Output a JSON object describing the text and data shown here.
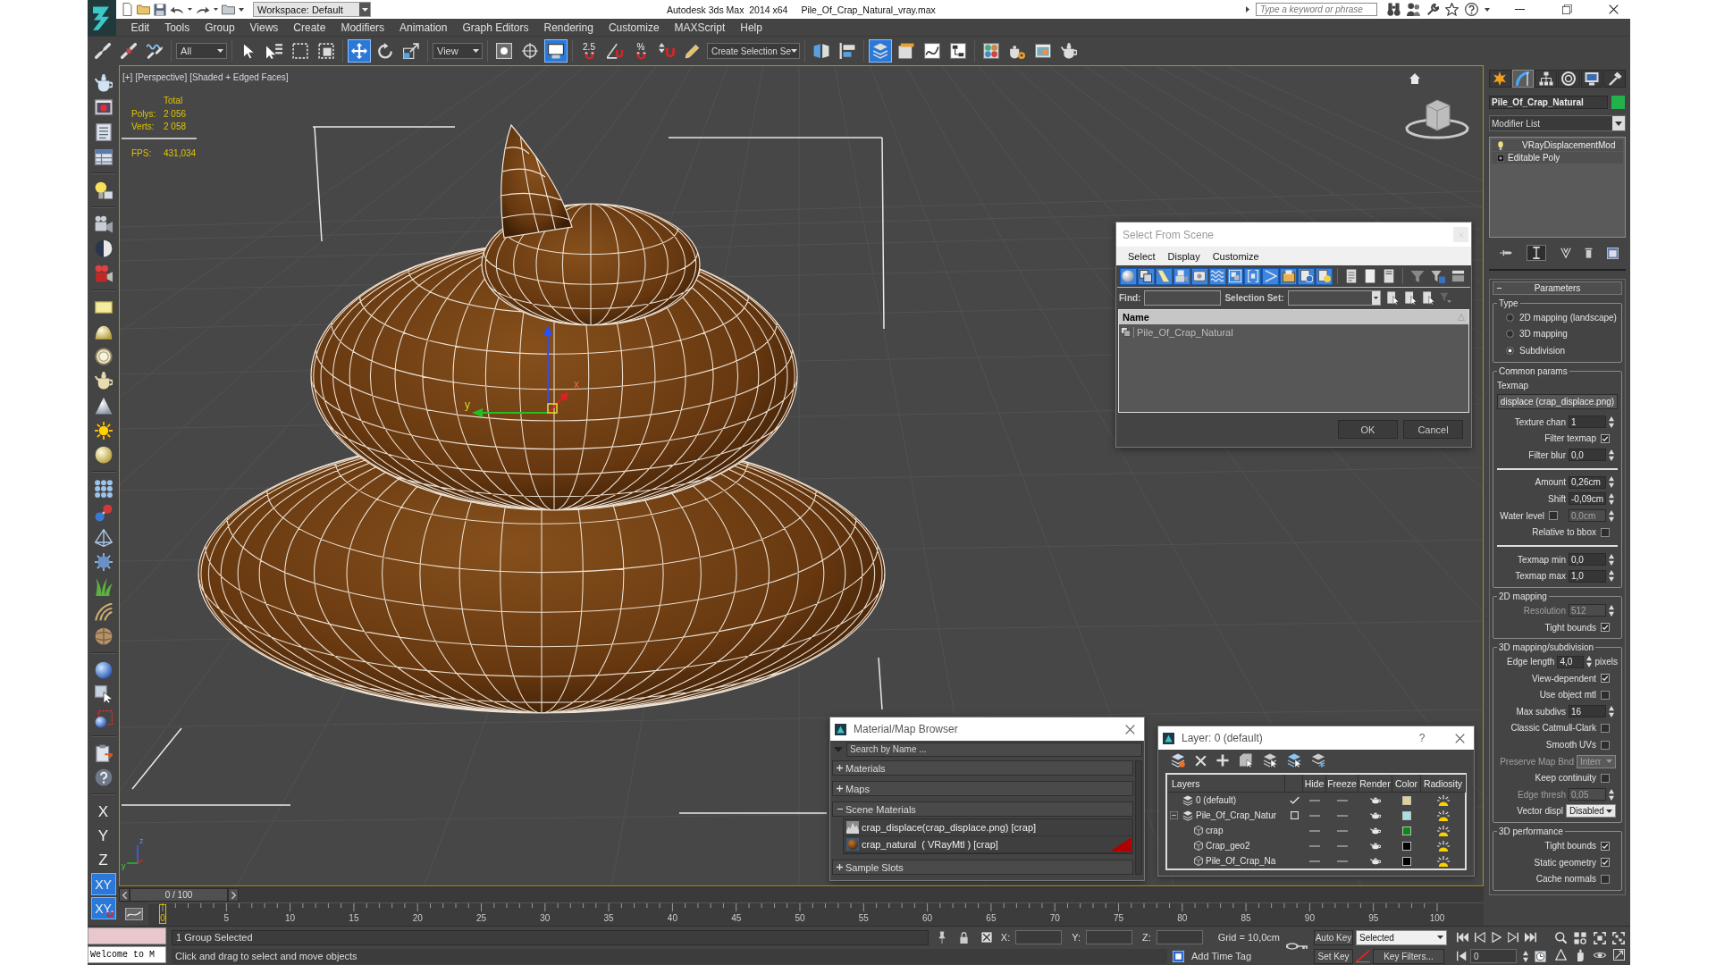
{
  "title_bar": {
    "workspace": "Workspace: Default",
    "app_title": "Autodesk 3ds Max  2014 x64",
    "file_name": "Pile_Of_Crap_Natural_vray.max",
    "search_placeholder": "Type a keyword or phrase"
  },
  "menu": [
    "Edit",
    "Tools",
    "Group",
    "Views",
    "Create",
    "Modifiers",
    "Animation",
    "Graph Editors",
    "Rendering",
    "Customize",
    "MAXScript",
    "Help"
  ],
  "main_toolbar": [
    {
      "kind": "button",
      "selected": false
    },
    {
      "kind": "button",
      "selected": false
    },
    {
      "kind": "button",
      "selected": false
    },
    {
      "kind": "dropdown",
      "value": "All"
    },
    {
      "kind": "button",
      "selected": false
    },
    {
      "kind": "button",
      "selected": false
    },
    {
      "kind": "button",
      "selected": false
    },
    {
      "kind": "button",
      "selected": false
    },
    {
      "kind": "button",
      "selected": true
    },
    {
      "kind": "button",
      "selected": false
    },
    {
      "kind": "button",
      "selected": false
    },
    {
      "kind": "dropdown",
      "value": "View"
    },
    {
      "kind": "button",
      "selected": false
    },
    {
      "kind": "button",
      "selected": false
    },
    {
      "kind": "button",
      "selected": true
    },
    {
      "kind": "snap",
      "label": "2.5",
      "selected": false
    },
    {
      "kind": "button",
      "selected": false
    },
    {
      "kind": "snap",
      "label": "%",
      "selected": false
    },
    {
      "kind": "button",
      "selected": false
    },
    {
      "kind": "button",
      "selected": false
    },
    {
      "kind": "dropdown",
      "value": "Create Selection Se"
    },
    {
      "kind": "button",
      "selected": false
    },
    {
      "kind": "button",
      "selected": false
    },
    {
      "kind": "button",
      "selected": true
    },
    {
      "kind": "button",
      "selected": false
    },
    {
      "kind": "button",
      "selected": false
    },
    {
      "kind": "button",
      "selected": false
    },
    {
      "kind": "button",
      "selected": false
    },
    {
      "kind": "button",
      "selected": false
    },
    {
      "kind": "button",
      "selected": false
    },
    {
      "kind": "button",
      "selected": false
    }
  ],
  "axis_constraints": [
    {
      "label": "X",
      "kind": "axis",
      "selected": false
    },
    {
      "label": "Y",
      "kind": "axis",
      "selected": false
    },
    {
      "label": "Z",
      "kind": "axis",
      "selected": false
    },
    {
      "label": "XY",
      "kind": "axis",
      "selected": true
    },
    {
      "label": "XY",
      "kind": "snap-axis",
      "selected": true
    }
  ],
  "viewport": {
    "labels": [
      "[+]",
      "[Perspective]",
      "[Shaded + Edged Faces]"
    ],
    "stats": {
      "heading": "Total",
      "rows": [
        {
          "label": "Polys:",
          "value": "2 056"
        },
        {
          "label": "Verts:",
          "value": "2 058"
        }
      ],
      "fps_label": "FPS:",
      "fps_value": "431,034"
    },
    "gizmo_labels": [
      "y",
      "x"
    ],
    "tripod_labels": [
      "z",
      "y"
    ]
  },
  "select_from_scene": {
    "title": "Select From Scene",
    "menu": [
      "Select",
      "Display",
      "Customize"
    ],
    "type_filters": [
      {
        "selected": true
      },
      {
        "selected": true
      },
      {
        "selected": true
      },
      {
        "selected": true
      },
      {
        "selected": true
      },
      {
        "selected": true
      },
      {
        "selected": true
      },
      {
        "selected": true
      },
      {
        "selected": true
      },
      {
        "selected": true
      },
      {
        "selected": true
      },
      {
        "selected": true
      }
    ],
    "find_label": "Find:",
    "selection_set_label": "Selection Set:",
    "column": "Name",
    "rows": [
      {
        "name": "Pile_Of_Crap_Natural",
        "selected": false
      }
    ],
    "buttons": [
      "OK",
      "Cancel"
    ]
  },
  "material_browser": {
    "title": "Material/Map Browser",
    "search_placeholder": "Search by Name ...",
    "groups": [
      {
        "label": "Materials",
        "expanded": false
      },
      {
        "label": "Maps",
        "expanded": false
      },
      {
        "label": "Scene Materials",
        "expanded": true,
        "items": [
          {
            "label": "crap_displace(crap_displace.png) [crap]",
            "kind": "map",
            "marked": false
          },
          {
            "label": "crap_natural  ( VRayMtl ) [crap]",
            "kind": "material",
            "marked": true
          }
        ]
      },
      {
        "label": "Sample Slots",
        "expanded": false
      }
    ]
  },
  "layer_manager": {
    "title": "Layer: 0 (default)",
    "help": "?",
    "columns": [
      "Layers",
      "Hide",
      "Freeze",
      "Render",
      "Color",
      "Radiosity"
    ],
    "layers": [
      {
        "name": "0 (default)",
        "current": true,
        "hidden": false,
        "frozen": false,
        "renderable": true,
        "radiosity": true,
        "color": "#e6d18c"
      },
      {
        "name": "Pile_Of_Crap_Natur",
        "current": false,
        "expanded": true,
        "hidden": false,
        "frozen": false,
        "renderable": true,
        "radiosity": true,
        "color": "#a4e2e2",
        "children": [
          {
            "name": "crap",
            "hidden": false,
            "frozen": false,
            "renderable": true,
            "radiosity": true,
            "color": "#0b8a12"
          },
          {
            "name": "Crap_geo2",
            "hidden": false,
            "frozen": false,
            "renderable": true,
            "radiosity": true,
            "color": "#000000"
          },
          {
            "name": "Pile_Of_Crap_Na",
            "hidden": false,
            "frozen": false,
            "renderable": true,
            "radiosity": true,
            "color": "#000000"
          }
        ]
      }
    ]
  },
  "command_panel": {
    "tabs": [
      {
        "selected": false
      },
      {
        "selected": true
      },
      {
        "selected": false
      },
      {
        "selected": false
      },
      {
        "selected": false
      },
      {
        "selected": false
      }
    ],
    "object": {
      "name": "Pile_Of_Crap_Natural",
      "color": "#22b24c"
    },
    "modifier_list": "Modifier List",
    "stack": [
      {
        "label": "VRayDisplacementMod",
        "kind": "modifier",
        "selected": false
      },
      {
        "label": "Editable Poly",
        "kind": "base-object",
        "selected": false
      }
    ],
    "rollout": {
      "title": "Parameters",
      "expanded": true,
      "groups": [
        {
          "title": "Type",
          "sections": [
            [
              {
                "kind": "radio",
                "label": "2D mapping (landscape)",
                "selected": false
              },
              {
                "kind": "radio",
                "label": "3D mapping",
                "selected": false
              },
              {
                "kind": "radio",
                "label": "Subdivision",
                "selected": true
              }
            ]
          ]
        },
        {
          "title": "Common params",
          "texmap_label": "Texmap",
          "texmap": "displace (crap_displace.png)",
          "sections": [
            [
              {
                "kind": "spinner",
                "label": "Texture chan",
                "value": "1",
                "disabled": false
              },
              {
                "kind": "checkbox",
                "label": "Filter texmap",
                "checked": true,
                "disabled": false
              },
              {
                "kind": "spinner",
                "label": "Filter blur",
                "value": "0,0",
                "disabled": false
              }
            ],
            [
              {
                "kind": "spinner",
                "label": "Amount",
                "value": "0,26cm",
                "disabled": false
              },
              {
                "kind": "spinner",
                "label": "Shift",
                "value": "-0,09cm",
                "disabled": false
              },
              {
                "kind": "check-spinner",
                "label": "Water level",
                "checked": false,
                "value": "0,0cm",
                "disabled": true
              },
              {
                "kind": "checkbox",
                "label": "Relative to bbox",
                "checked": false,
                "disabled": false
              }
            ],
            [
              {
                "kind": "spinner",
                "label": "Texmap min",
                "value": "0,0",
                "disabled": false
              },
              {
                "kind": "spinner",
                "label": "Texmap max",
                "value": "1,0",
                "disabled": false
              }
            ]
          ]
        },
        {
          "title": "2D mapping",
          "sections": [
            [
              {
                "kind": "spinner",
                "label": "Resolution",
                "value": "512",
                "disabled": true
              },
              {
                "kind": "checkbox",
                "label": "Tight bounds",
                "checked": true,
                "disabled": false
              }
            ]
          ]
        },
        {
          "title": "3D mapping/subdivision",
          "sections": [
            [
              {
                "kind": "spinner",
                "label": "Edge length",
                "value": "4,0",
                "unit": "pixels",
                "disabled": false
              },
              {
                "kind": "checkbox",
                "label": "View-dependent",
                "checked": true,
                "disabled": false
              },
              {
                "kind": "checkbox",
                "label": "Use object mtl",
                "checked": false,
                "disabled": false
              },
              {
                "kind": "spinner",
                "label": "Max subdivs",
                "value": "16",
                "disabled": false
              },
              {
                "kind": "checkbox",
                "label": "Classic Catmull-Clark",
                "checked": false,
                "disabled": false
              },
              {
                "kind": "checkbox",
                "label": "Smooth UVs",
                "checked": false,
                "disabled": false
              },
              {
                "kind": "dropdown",
                "label": "Preserve Map Bnd",
                "value": "Interr",
                "disabled": true
              },
              {
                "kind": "checkbox",
                "label": "Keep continuity",
                "checked": false,
                "disabled": false
              },
              {
                "kind": "spinner",
                "label": "Edge thresh",
                "value": "0,05",
                "disabled": true
              },
              {
                "kind": "dropdown",
                "label": "Vector displ",
                "value": "Disabled",
                "disabled": false
              }
            ]
          ]
        },
        {
          "title": "3D performance",
          "sections": [
            [
              {
                "kind": "checkbox",
                "label": "Tight bounds",
                "checked": true,
                "disabled": false
              },
              {
                "kind": "checkbox",
                "label": "Static geometry",
                "checked": true,
                "disabled": false
              },
              {
                "kind": "checkbox",
                "label": "Cache normals",
                "checked": false,
                "disabled": false
              }
            ]
          ]
        }
      ]
    }
  },
  "time_slider": {
    "position": "0 / 100",
    "level": 0
  },
  "track_bar": {
    "current_frame": "0",
    "labels": [
      "5",
      "10",
      "15",
      "20",
      "25",
      "30",
      "35",
      "40",
      "45",
      "50",
      "55",
      "60",
      "65",
      "70",
      "75",
      "80",
      "85",
      "90",
      "95",
      "100"
    ]
  },
  "status_bar": {
    "listener_output": "Welcome to M",
    "selection_info": "1 Group Selected",
    "prompt": "Click and drag to select and move objects",
    "coordinates": [
      "X:",
      "Y:",
      "Z:"
    ],
    "grid": "Grid = 10,0cm",
    "time_tag": "Add Time Tag",
    "auto_key": "Auto Key",
    "key_mode": "Selected",
    "set_key": "Set Key",
    "key_filters": "Key Filters...",
    "frame": "0"
  }
}
